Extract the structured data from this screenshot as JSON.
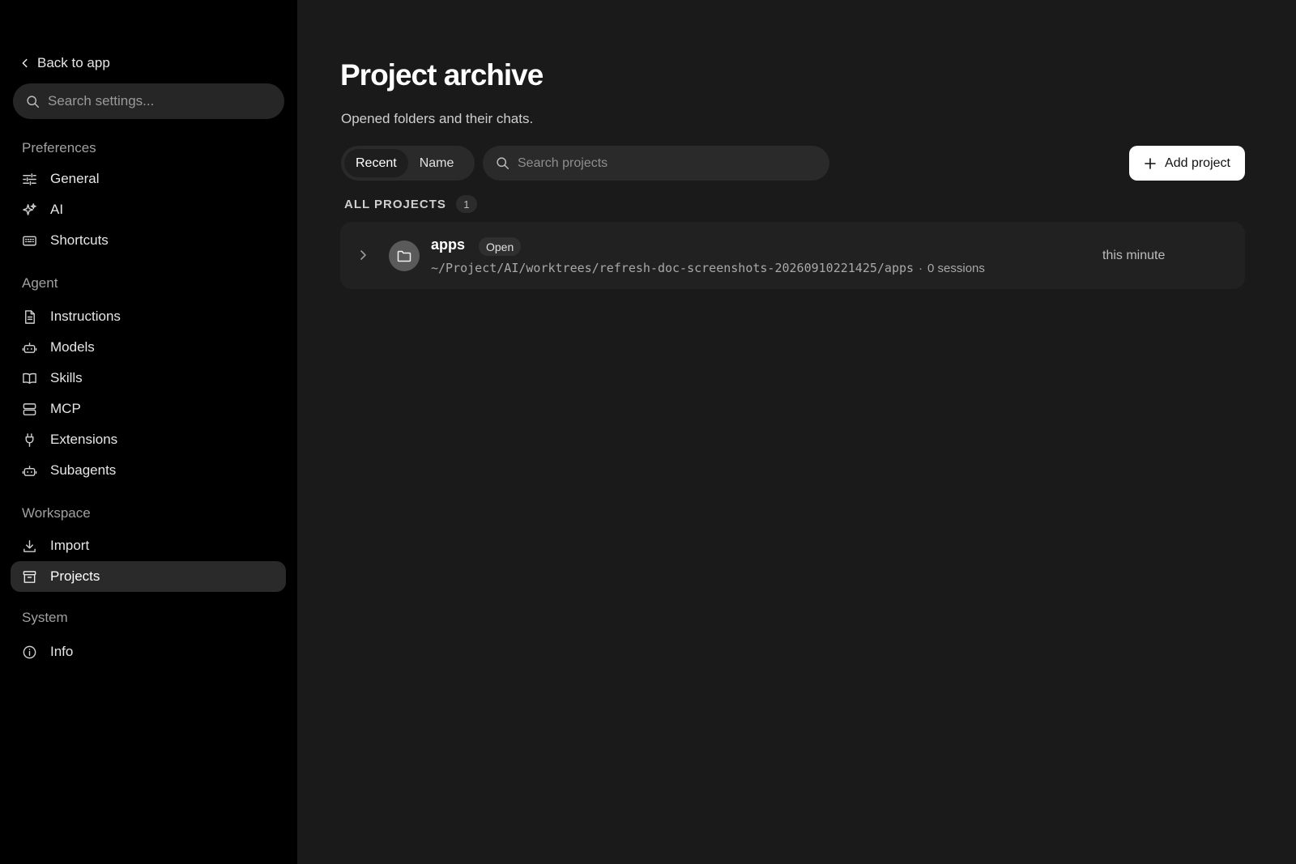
{
  "sidebar": {
    "back_label": "Back to app",
    "search_placeholder": "Search settings...",
    "sections": {
      "preferences": {
        "title": "Preferences",
        "items": {
          "general": "General",
          "ai": "AI",
          "shortcuts": "Shortcuts"
        }
      },
      "agent": {
        "title": "Agent",
        "items": {
          "instructions": "Instructions",
          "models": "Models",
          "skills": "Skills",
          "mcp": "MCP",
          "extensions": "Extensions",
          "subagents": "Subagents"
        }
      },
      "workspace": {
        "title": "Workspace",
        "items": {
          "import": "Import",
          "projects": "Projects"
        }
      },
      "system": {
        "title": "System",
        "items": {
          "info": "Info"
        }
      }
    },
    "active_item": "Projects"
  },
  "main": {
    "title": "Project archive",
    "subtitle": "Opened folders and their chats.",
    "sort_tabs": {
      "recent": "Recent",
      "name": "Name",
      "active": "Recent"
    },
    "search_placeholder": "Search projects",
    "add_button_label": "Add project",
    "group": {
      "label": "ALL PROJECTS",
      "count": "1"
    },
    "projects": [
      {
        "name": "apps",
        "status": "Open",
        "path": "~/Project/AI/worktrees/refresh-doc-screenshots-20260910221425/apps",
        "separator": "·",
        "sessions": "0 sessions",
        "time": "this minute"
      }
    ]
  },
  "colors": {
    "sidebar_bg": "#000000",
    "main_bg": "#1a1a1a",
    "active_item_bg": "#2a2a2a",
    "primary_button_bg": "#ffffff"
  },
  "icons": {
    "back": "chevron-left-icon",
    "search": "search-icon",
    "general": "sliders-icon",
    "ai": "sparkles-icon",
    "shortcuts": "keyboard-icon",
    "instructions": "document-icon",
    "models": "robot-icon",
    "skills": "book-icon",
    "mcp": "server-icon",
    "extensions": "plug-icon",
    "subagents": "robot-icon",
    "import": "download-icon",
    "projects": "archive-icon",
    "info": "info-icon",
    "add": "plus-icon",
    "expand": "chevron-right-icon",
    "folder": "folder-icon"
  }
}
